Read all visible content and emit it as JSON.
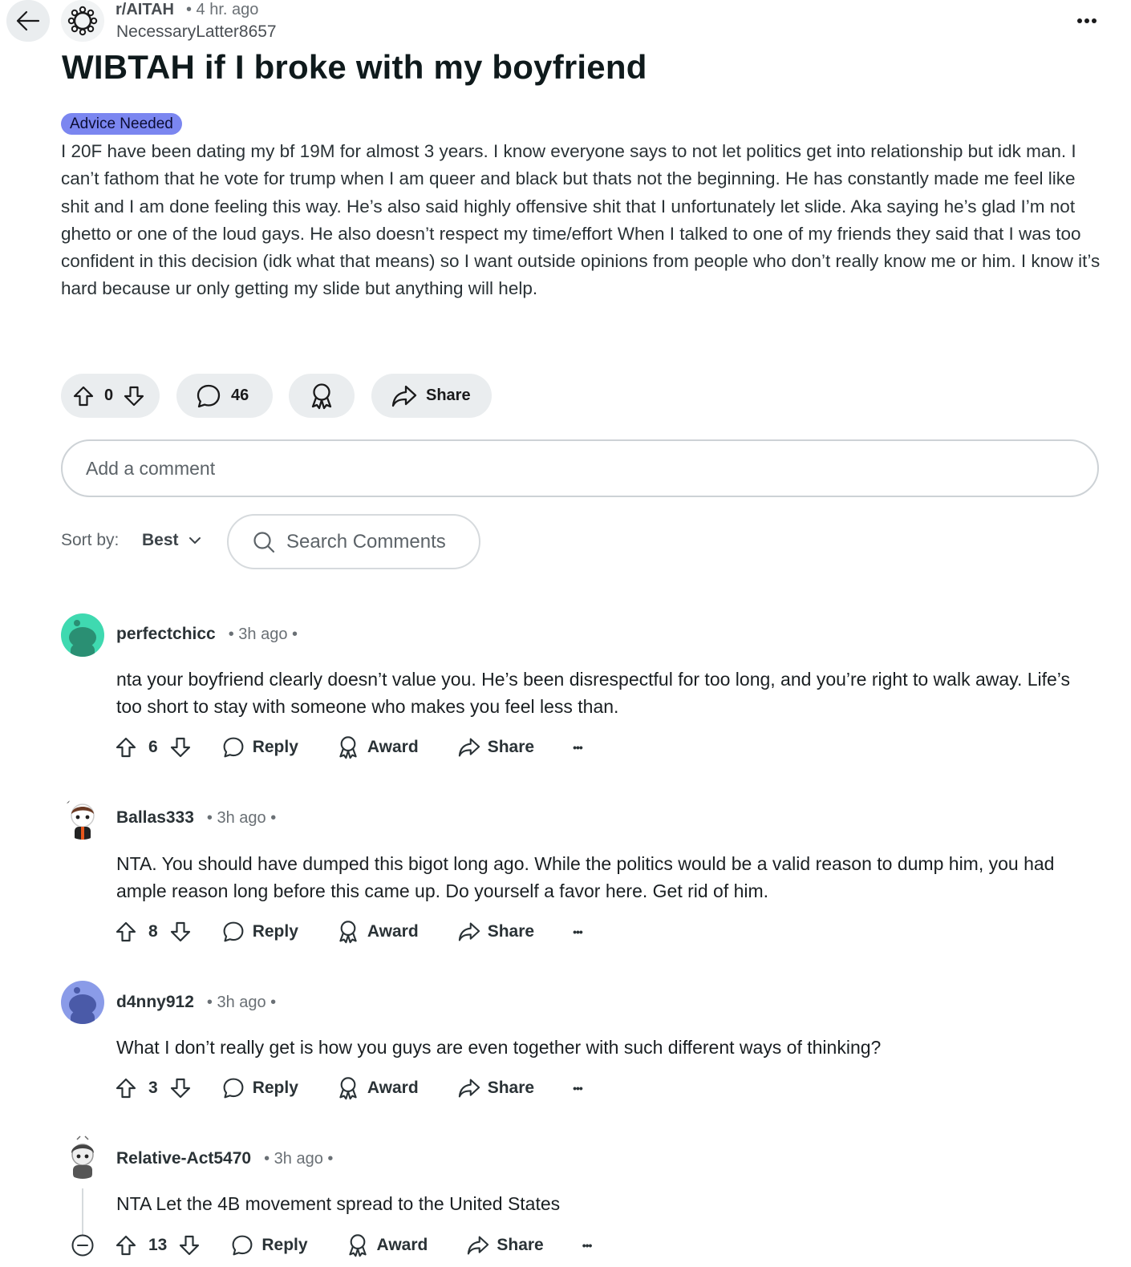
{
  "header": {
    "subreddit": "r/AITAH",
    "time": "• 4 hr. ago",
    "author": "NecessaryLatter8657",
    "overflow": "•••"
  },
  "post": {
    "title": "WIBTAH if I broke with my boyfriend",
    "flair": "Advice Needed",
    "body": "I 20F have been dating my bf 19M for almost 3 years. I know everyone says to not let politics get into relationship but idk man. I can’t fathom that he vote for trump when I am queer and black but thats not the beginning. He has constantly made me feel like shit and I am done feeling this way. He’s also said highly offensive shit that I unfortunately let slide. Aka saying he’s glad I’m not ghetto or one of the loud gays. He also doesn’t respect my time/effort When I talked to one of my friends they said that I was too confident in this decision (idk what that means) so I want outside opinions from people who don’t really know me or him. I know it’s hard because ur only getting my slide but anything will help."
  },
  "actions": {
    "votes": "0",
    "comments": "46",
    "share": "Share"
  },
  "comment_box": {
    "placeholder": "Add a comment"
  },
  "sort": {
    "label": "Sort by:",
    "value": "Best",
    "search_placeholder": "Search Comments"
  },
  "comments": [
    {
      "user": "perfectchicc",
      "time": "• 3h ago •",
      "text": "nta your boyfriend clearly doesn’t value you. He’s been disrespectful for too long, and you’re right to walk away. Life’s too short to stay with someone who makes you feel less than.",
      "votes": "6",
      "avatar_color": "#3fd9b0"
    },
    {
      "user": "Ballas333",
      "time": "• 3h ago •",
      "text": "NTA. You should have dumped this bigot long ago. While the politics would be a valid reason to dump him, you had ample reason long before this came up. Do yourself a favor here. Get rid of him.",
      "votes": "8",
      "avatar_color": "#ffffff"
    },
    {
      "user": "d4nny912",
      "time": "• 3h ago •",
      "text": "What I don’t really get is how you guys are even together with such different ways of thinking?",
      "votes": "3",
      "avatar_color": "#8a9be8"
    },
    {
      "user": "Relative-Act5470",
      "time": "• 3h ago •",
      "text": "NTA Let the 4B movement spread to the United States",
      "votes": "13",
      "avatar_color": "#ffffff"
    }
  ],
  "comment_action_labels": {
    "reply": "Reply",
    "award": "Award",
    "share": "Share",
    "more": "•••"
  }
}
